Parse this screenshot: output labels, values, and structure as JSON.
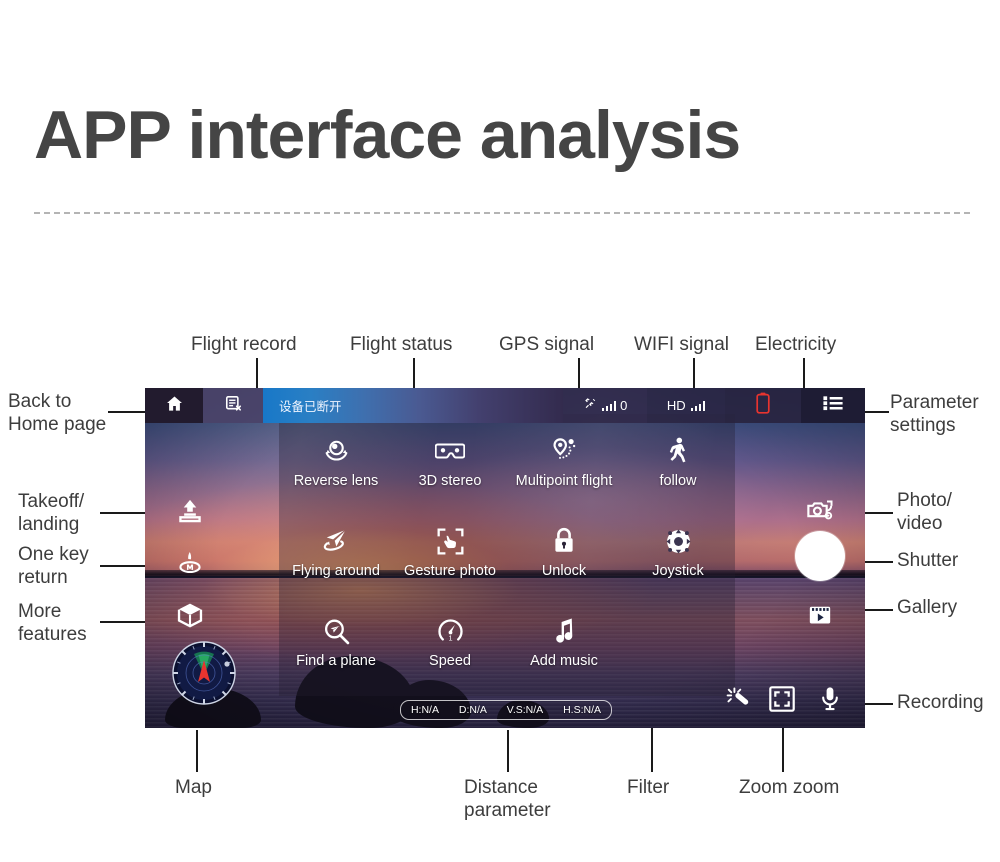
{
  "page": {
    "title": "APP interface analysis"
  },
  "app": {
    "top_bar": {
      "home_icon": "home-icon",
      "flight_record_icon": "flight-record-icon",
      "status_text": "设备已断开",
      "gps": {
        "icon": "satellite-icon",
        "value": "0"
      },
      "wifi": {
        "label": "HD",
        "icon": "signal-bars-icon"
      },
      "battery": {
        "icon": "battery-icon",
        "color": "#e8342f"
      },
      "settings_icon": "list-menu-icon"
    },
    "left_controls": [
      {
        "name": "takeoff-landing",
        "icon": "takeoff-landing-icon"
      },
      {
        "name": "one-key-return",
        "icon": "return-home-icon"
      },
      {
        "name": "more-features",
        "icon": "cube-icon"
      }
    ],
    "right_controls": [
      {
        "name": "photo-video-toggle",
        "icon": "camera-switch-icon"
      },
      {
        "name": "shutter",
        "icon": "shutter-circle-icon"
      },
      {
        "name": "gallery",
        "icon": "film-play-icon"
      }
    ],
    "features": [
      [
        {
          "label": "Reverse lens",
          "icon": "reverse-lens-icon"
        },
        {
          "label": "3D stereo",
          "icon": "vr-goggles-icon"
        },
        {
          "label": "Multipoint flight",
          "icon": "waypoint-icon"
        },
        {
          "label": "follow",
          "icon": "walking-person-icon"
        }
      ],
      [
        {
          "label": "Flying around",
          "icon": "paper-plane-orbit-icon"
        },
        {
          "label": "Gesture photo",
          "icon": "gesture-frame-icon"
        },
        {
          "label": "Unlock",
          "icon": "lock-icon"
        },
        {
          "label": "Joystick",
          "icon": "joystick-icon"
        }
      ],
      [
        {
          "label": "Find a plane",
          "icon": "find-plane-icon"
        },
        {
          "label": "Speed",
          "icon": "speedometer-icon"
        },
        {
          "label": "Add music",
          "icon": "music-note-icon"
        },
        {
          "label": "",
          "icon": ""
        }
      ]
    ],
    "map": {
      "name": "radar-map",
      "icon": "radar-compass-icon"
    },
    "distance_parameters": [
      "H:N/A",
      "D:N/A",
      "V.S:N/A",
      "H.S:N/A"
    ],
    "bottom_controls": [
      {
        "name": "filter",
        "icon": "magic-wand-icon"
      },
      {
        "name": "zoom",
        "icon": "focus-bracket-icon"
      },
      {
        "name": "recording",
        "icon": "microphone-icon"
      }
    ]
  },
  "annotations": {
    "back_to_home": "Back to\nHome page",
    "flight_record": "Flight record",
    "flight_status": "Flight status",
    "gps_signal": "GPS signal",
    "wifi_signal": "WIFI signal",
    "electricity": "Electricity",
    "parameter_settings": "Parameter\nsettings",
    "takeoff_landing": "Takeoff/\nlanding",
    "one_key_return": "One key\nreturn",
    "more_features": "More\nfeatures",
    "photo_video": "Photo/\nvideo",
    "shutter": "Shutter",
    "gallery": "Gallery",
    "map": "Map",
    "distance_parameter": "Distance\nparameter",
    "filter": "Filter",
    "zoom_zoom": "Zoom zoom",
    "recording": "Recording"
  }
}
